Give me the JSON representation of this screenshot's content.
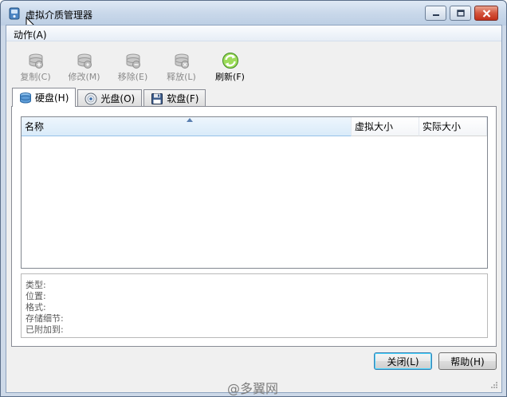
{
  "window": {
    "title": "虚拟介质管理器",
    "icon": "virtual-disk-icon",
    "controls": [
      "minimize-icon",
      "maximize-icon",
      "close-icon"
    ]
  },
  "menu": {
    "items": [
      {
        "label": "动作(A)"
      }
    ]
  },
  "toolbar": {
    "buttons": [
      {
        "label": "复制(C)",
        "icon": "copy-disk-icon",
        "enabled": false
      },
      {
        "label": "修改(M)",
        "icon": "modify-disk-icon",
        "enabled": false
      },
      {
        "label": "移除(E)",
        "icon": "remove-disk-icon",
        "enabled": false
      },
      {
        "label": "释放(L)",
        "icon": "release-disk-icon",
        "enabled": false
      },
      {
        "label": "刷新(F)",
        "icon": "refresh-icon",
        "enabled": true
      }
    ]
  },
  "tabs": [
    {
      "label": "硬盘(H)",
      "icon": "hard-disk-icon",
      "active": true
    },
    {
      "label": "光盘(O)",
      "icon": "optical-disc-icon",
      "active": false
    },
    {
      "label": "软盘(F)",
      "icon": "floppy-disk-icon",
      "active": false
    }
  ],
  "list": {
    "columns": [
      {
        "label": "名称",
        "sorted": true
      },
      {
        "label": "虚拟大小",
        "sorted": false
      },
      {
        "label": "实际大小",
        "sorted": false
      }
    ],
    "rows": []
  },
  "details": {
    "labels": [
      "类型:",
      "位置:",
      "格式:",
      "存储细节:",
      "已附加到:"
    ]
  },
  "buttons": {
    "close": "关闭(L)",
    "help": "帮助(H)"
  },
  "watermark": "@多翼网",
  "colors": {
    "title_bar": "#c9d8ea",
    "close_button": "#c2301a",
    "default_button_border": "#3c7fb1",
    "sorted_column": "#d9ebf9",
    "disabled_text": "#8a8a8a"
  }
}
